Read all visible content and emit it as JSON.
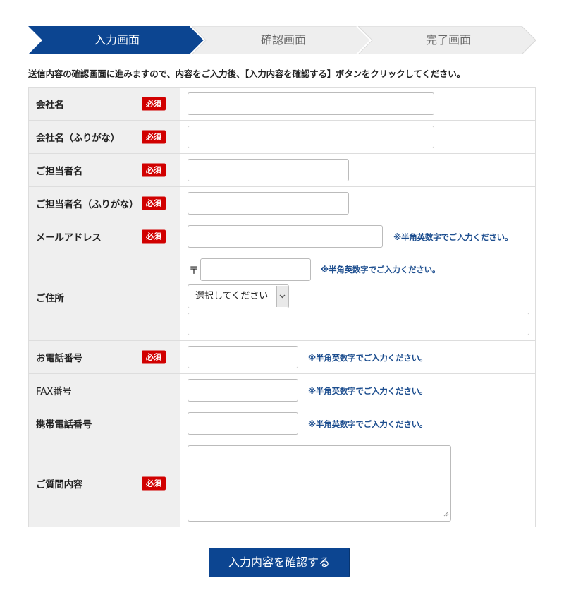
{
  "steps": [
    {
      "label": "入力画面",
      "active": true
    },
    {
      "label": "確認画面",
      "active": false
    },
    {
      "label": "完了画面",
      "active": false
    }
  ],
  "colors": {
    "active_step": "#0c4591",
    "inactive_step": "#eeeeee",
    "required_badge": "#d10000",
    "note_text": "#1d4e8f"
  },
  "intro_text": "送信内容の確認画面に進みますので、内容をご入力後、【入力内容を確認する】ボタンをクリックしてください。",
  "required_label": "必須",
  "fields": {
    "company": {
      "label": "会社名",
      "value": ""
    },
    "company_kana": {
      "label": "会社名（ふりがな）",
      "value": ""
    },
    "person": {
      "label": "ご担当者名",
      "value": ""
    },
    "person_kana": {
      "label": "ご担当者名（ふりがな）",
      "value": ""
    },
    "email": {
      "label": "メールアドレス",
      "value": "",
      "note": "※半角英数字でご入力ください。"
    },
    "address": {
      "label": "ご住所",
      "zip_mark": "〒",
      "zip_value": "",
      "zip_note": "※半角英数字でご入力ください。",
      "prefecture_selected": "選択してください",
      "street_value": ""
    },
    "phone": {
      "label": "お電話番号",
      "value": "",
      "note": "※半角英数字でご入力ください。"
    },
    "fax": {
      "label": "FAX番号",
      "value": "",
      "note": "※半角英数字でご入力ください。"
    },
    "mobile": {
      "label": "携帯電話番号",
      "value": "",
      "note": "※半角英数字でご入力ください。"
    },
    "inquiry": {
      "label": "ご質問内容",
      "value": ""
    }
  },
  "submit_label": "入力内容を確認する"
}
